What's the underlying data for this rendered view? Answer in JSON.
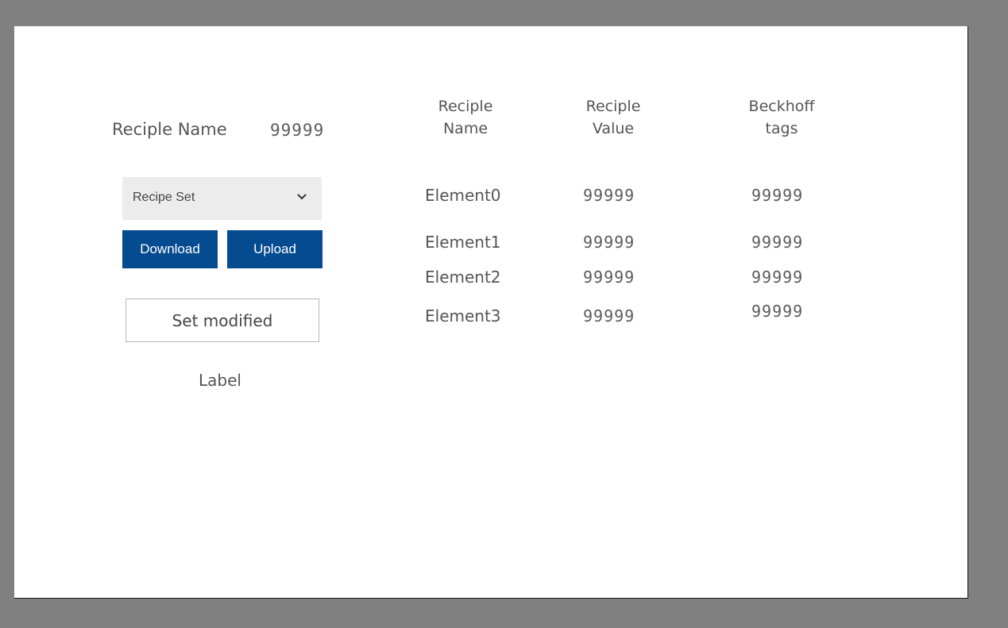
{
  "recipe": {
    "name_label": "Reciple Name",
    "name_value": "99999"
  },
  "controls": {
    "dropdown_value": "Recipe Set",
    "download_label": "Download",
    "upload_label": "Upload",
    "set_modified_label": "Set modified",
    "status_label": "Label"
  },
  "table": {
    "headers": [
      {
        "line1": "Reciple",
        "line2": "Name"
      },
      {
        "line1": "Reciple",
        "line2": "Value"
      },
      {
        "line1": "Beckhoff",
        "line2": "tags"
      }
    ],
    "rows": [
      {
        "name": "Element0",
        "value": "99999",
        "tag": "99999"
      },
      {
        "name": "Element1",
        "value": "99999",
        "tag": "99999"
      },
      {
        "name": "Element2",
        "value": "99999",
        "tag": "99999"
      },
      {
        "name": "Element3",
        "value": "99999",
        "tag": "99999"
      }
    ]
  },
  "colors": {
    "background": "#808080",
    "panel": "#ffffff",
    "button_blue": "#044b8f",
    "dropdown_bg": "#ececec"
  },
  "icons": {
    "dropdown": "chevron-down-icon"
  }
}
